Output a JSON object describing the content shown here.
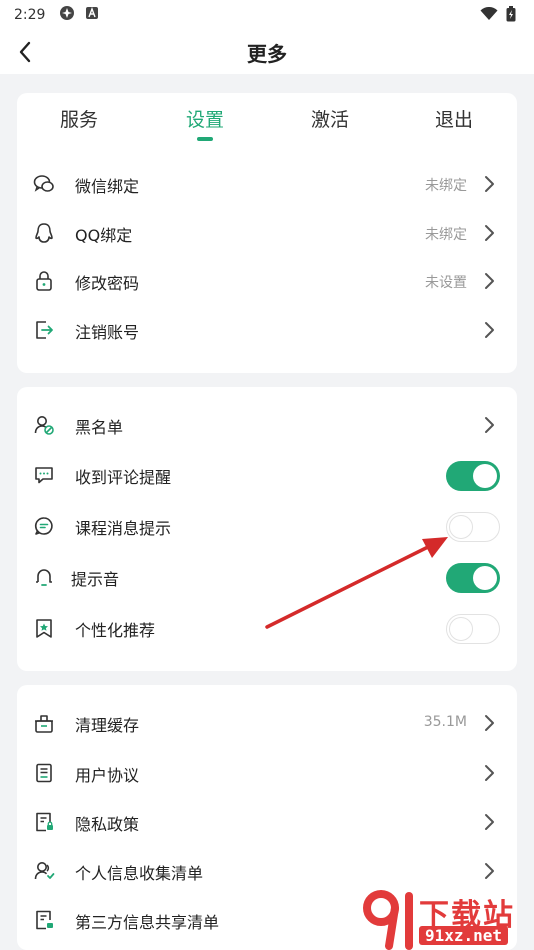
{
  "status_bar": {
    "time": "2:29",
    "icons": [
      "settings-status-icon",
      "a-status-icon",
      "wifi-icon",
      "battery-icon"
    ]
  },
  "header": {
    "title": "更多",
    "back_icon": "chevron-left-icon"
  },
  "tabs": {
    "items": [
      {
        "label": "服务",
        "active": false
      },
      {
        "label": "设置",
        "active": true
      },
      {
        "label": "激活",
        "active": false
      },
      {
        "label": "退出",
        "active": false
      }
    ]
  },
  "account": {
    "items": [
      {
        "label": "微信绑定",
        "value": "未绑定",
        "icon": "wechat-icon"
      },
      {
        "label": "QQ绑定",
        "value": "未绑定",
        "icon": "qq-icon"
      },
      {
        "label": "修改密码",
        "value": "未设置",
        "icon": "lock-icon"
      },
      {
        "label": "注销账号",
        "value": "",
        "icon": "logout-icon"
      }
    ]
  },
  "settings": {
    "items": [
      {
        "label": "黑名单",
        "icon": "blocked-user-icon",
        "type": "link"
      },
      {
        "label": "收到评论提醒",
        "icon": "comment-icon",
        "type": "toggle",
        "on": true
      },
      {
        "label": "课程消息提示",
        "icon": "message-icon",
        "type": "toggle",
        "on": false
      },
      {
        "label": "提示音",
        "icon": "bell-icon",
        "type": "toggle",
        "on": true
      },
      {
        "label": "个性化推荐",
        "icon": "bookmark-star-icon",
        "type": "toggle",
        "on": false
      }
    ]
  },
  "misc": {
    "items": [
      {
        "label": "清理缓存",
        "value": "35.1M",
        "icon": "broom-icon"
      },
      {
        "label": "用户协议",
        "value": "",
        "icon": "document-icon"
      },
      {
        "label": "隐私政策",
        "value": "",
        "icon": "privacy-doc-icon"
      },
      {
        "label": "个人信息收集清单",
        "value": "",
        "icon": "user-list-icon"
      },
      {
        "label": "第三方信息共享清单",
        "value": "",
        "icon": "share-doc-icon"
      }
    ]
  },
  "colors": {
    "accent": "#21a876",
    "annotation_arrow": "#d42a2a",
    "watermark": "#e23b3b"
  },
  "watermark": {
    "text": "下载站",
    "url": "91xz.net"
  }
}
